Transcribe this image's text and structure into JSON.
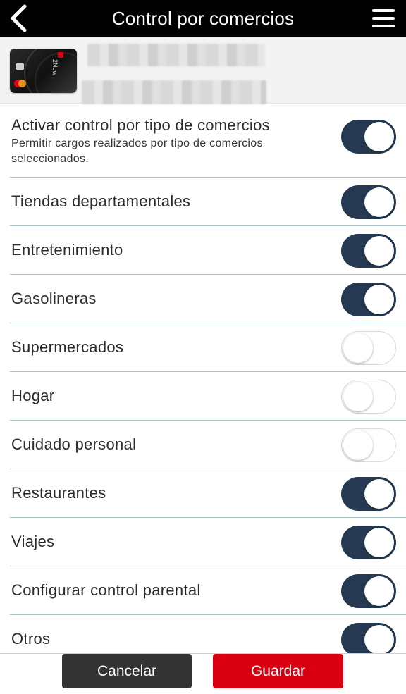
{
  "header": {
    "title": "Control por comercios",
    "back_icon": "chevron-left-icon",
    "menu_icon": "hamburger-menu-icon"
  },
  "card": {
    "brand_text": "2Now"
  },
  "settings": {
    "master": {
      "label": "Activar control por tipo de comercios",
      "description": "Permitir cargos realizados por tipo de comercios seleccionados.",
      "enabled": true
    },
    "items": [
      {
        "label": "Tiendas departamentales",
        "enabled": true
      },
      {
        "label": "Entretenimiento",
        "enabled": true
      },
      {
        "label": "Gasolineras",
        "enabled": true
      },
      {
        "label": "Supermercados",
        "enabled": false
      },
      {
        "label": "Hogar",
        "enabled": false
      },
      {
        "label": "Cuidado personal",
        "enabled": false
      },
      {
        "label": "Restaurantes",
        "enabled": true
      },
      {
        "label": "Viajes",
        "enabled": true
      },
      {
        "label": "Configurar control parental",
        "enabled": true
      },
      {
        "label": "Otros",
        "enabled": true
      }
    ]
  },
  "footer": {
    "cancel_label": "Cancelar",
    "save_label": "Guardar"
  },
  "colors": {
    "header_bg": "#000000",
    "toggle_on": "#253a52",
    "save_button": "#db0011",
    "cancel_button": "#333333",
    "divider": "#a7c0c6"
  }
}
